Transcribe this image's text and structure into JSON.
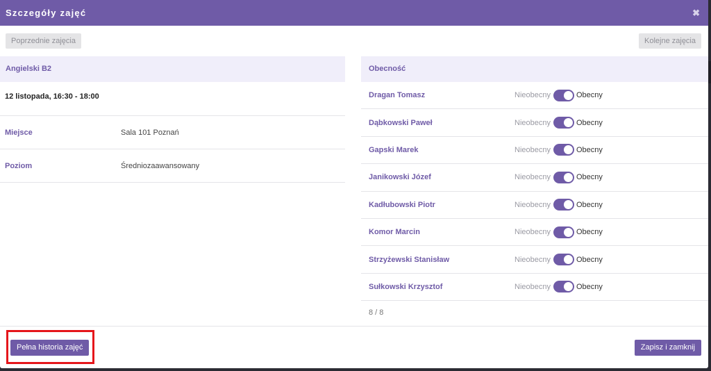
{
  "modal": {
    "title": "Szczegóły zajęć",
    "close_symbol": "✖"
  },
  "nav": {
    "prev_label": "Poprzednie zajęcia",
    "next_label": "Kolejne zajęcia"
  },
  "details": {
    "course": "Angielski B2",
    "date": "12 listopada, 16:30 - 18:00",
    "rows": [
      {
        "label": "Miejsce",
        "value": "Sala 101 Poznań"
      },
      {
        "label": "Poziom",
        "value": "Średniozaawansowany"
      }
    ]
  },
  "attendance": {
    "header": "Obecność",
    "absent_label": "Nieobecny",
    "present_label": "Obecny",
    "students": [
      {
        "name": "Dragan Tomasz",
        "present": true
      },
      {
        "name": "Dąbkowski Paweł",
        "present": true
      },
      {
        "name": "Gapski Marek",
        "present": true
      },
      {
        "name": "Janikowski Józef",
        "present": true
      },
      {
        "name": "Kadłubowski Piotr",
        "present": true
      },
      {
        "name": "Komor Marcin",
        "present": true
      },
      {
        "name": "Strzyżewski Stanisław",
        "present": true
      },
      {
        "name": "Sułkowski Krzysztof",
        "present": true
      }
    ],
    "count": "8 / 8"
  },
  "footer": {
    "history_label": "Pełna historia zajęć",
    "save_label": "Zapisz i zamknij"
  },
  "colors": {
    "accent": "#6f5ba7",
    "panel_header_bg": "#f0eefa",
    "highlight": "#e5161b"
  }
}
